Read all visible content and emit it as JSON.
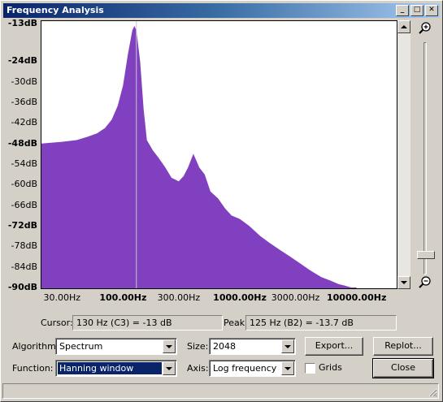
{
  "window": {
    "title": "Frequency Analysis"
  },
  "title_buttons": {
    "minimize": "_",
    "maximize": "□",
    "close": "✕"
  },
  "colors": {
    "spectrum_fill": "#8040c0",
    "title_bar": "#0a246a",
    "cursor_line": "#c8c8c8"
  },
  "chart_data": {
    "type": "area",
    "x_scale": "log",
    "xlim": [
      20,
      22050
    ],
    "ylim": [
      -90,
      -13
    ],
    "x_tick_labels": [
      {
        "x": 30,
        "label": "30.00Hz",
        "bold": false
      },
      {
        "x": 100,
        "label": "100.00Hz",
        "bold": true
      },
      {
        "x": 300,
        "label": "300.00Hz",
        "bold": false
      },
      {
        "x": 1000,
        "label": "1000.00Hz",
        "bold": true
      },
      {
        "x": 3000,
        "label": "3000.00Hz",
        "bold": false
      },
      {
        "x": 10000,
        "label": "10000.00Hz",
        "bold": true
      }
    ],
    "y_tick_labels": [
      {
        "y": -13,
        "label": "-13dB",
        "bold": true
      },
      {
        "y": -24,
        "label": "-24dB",
        "bold": true
      },
      {
        "y": -30,
        "label": "-30dB",
        "bold": false
      },
      {
        "y": -36,
        "label": "-36dB",
        "bold": false
      },
      {
        "y": -42,
        "label": "-42dB",
        "bold": false
      },
      {
        "y": -48,
        "label": "-48dB",
        "bold": true
      },
      {
        "y": -54,
        "label": "-54dB",
        "bold": false
      },
      {
        "y": -60,
        "label": "-60dB",
        "bold": false
      },
      {
        "y": -66,
        "label": "-66dB",
        "bold": false
      },
      {
        "y": -72,
        "label": "-72dB",
        "bold": true
      },
      {
        "y": -78,
        "label": "-78dB",
        "bold": false
      },
      {
        "y": -84,
        "label": "-84dB",
        "bold": false
      },
      {
        "y": -90,
        "label": "-90dB",
        "bold": true
      }
    ],
    "cursor_x": 130,
    "x": [
      20,
      30,
      40,
      50,
      60,
      70,
      80,
      90,
      100,
      110,
      120,
      125,
      130,
      140,
      150,
      160,
      180,
      200,
      230,
      260,
      300,
      330,
      360,
      400,
      450,
      500,
      560,
      650,
      750,
      850,
      1000,
      1200,
      1500,
      1800,
      2200,
      2700,
      3300,
      4000,
      5000,
      6000,
      7000,
      8000,
      9000,
      10000
    ],
    "y": [
      -48,
      -47.5,
      -47,
      -46,
      -45,
      -43.5,
      -41,
      -37,
      -31,
      -22,
      -15,
      -13.7,
      -15,
      -24,
      -38,
      -47,
      -50,
      -52,
      -55,
      -58,
      -59,
      -57.5,
      -55,
      -51,
      -55,
      -57,
      -62,
      -64,
      -67,
      -69,
      -70,
      -72,
      -75,
      -77,
      -79,
      -81,
      -83,
      -85,
      -87,
      -88,
      -89,
      -89.5,
      -90,
      -90
    ],
    "grid": false,
    "legend": "none"
  },
  "readouts": {
    "cursor_label": "Cursor:",
    "cursor_value": "130 Hz (C3) = -13 dB",
    "peak_label": "Peak:",
    "peak_value": "125 Hz (B2) = -13.7 dB"
  },
  "controls": {
    "algorithm_label": "Algorithm:",
    "algorithm_value": "Spectrum",
    "size_label": "Size:",
    "size_value": "2048",
    "function_label": "Function:",
    "function_value": "Hanning window",
    "axis_label": "Axis:",
    "axis_value": "Log frequency",
    "grids_label": "Grids",
    "grids_checked": false,
    "export_button": "Export...",
    "replot_button": "Replot...",
    "close_button": "Close"
  },
  "zoom": {
    "level": 0.93
  }
}
